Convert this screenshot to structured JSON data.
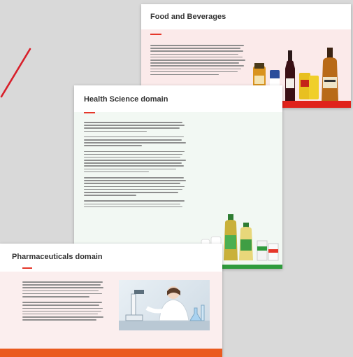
{
  "cards": {
    "food": {
      "title": "Food and Beverages"
    },
    "health": {
      "title": "Health Science domain"
    },
    "pharma": {
      "title": "Pharmaceuticals domain"
    }
  },
  "colors": {
    "accent": "#e5372a",
    "food_band": "#e0221b",
    "health_band": "#2f9b3d",
    "pharma_band": "#ea5a1e"
  }
}
